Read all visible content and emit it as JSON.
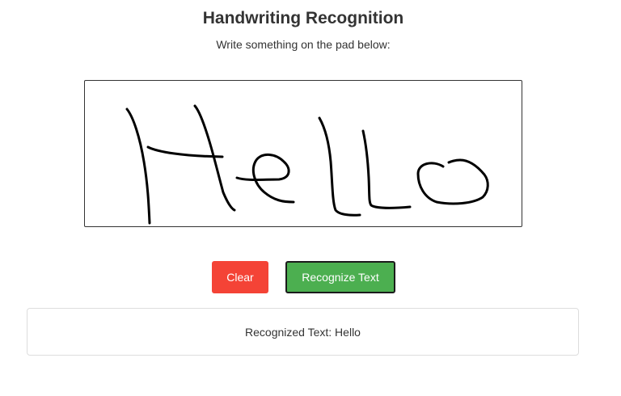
{
  "header": {
    "title": "Handwriting Recognition",
    "subtitle": "Write something on the pad below:"
  },
  "canvas": {
    "stroke_color": "#000000",
    "content": "handwritten \"Hello\""
  },
  "buttons": {
    "clear_label": "Clear",
    "clear_color": "#f44336",
    "recognize_label": "Recognize Text",
    "recognize_color": "#4caf50"
  },
  "result": {
    "text": "Recognized Text: Hello"
  }
}
